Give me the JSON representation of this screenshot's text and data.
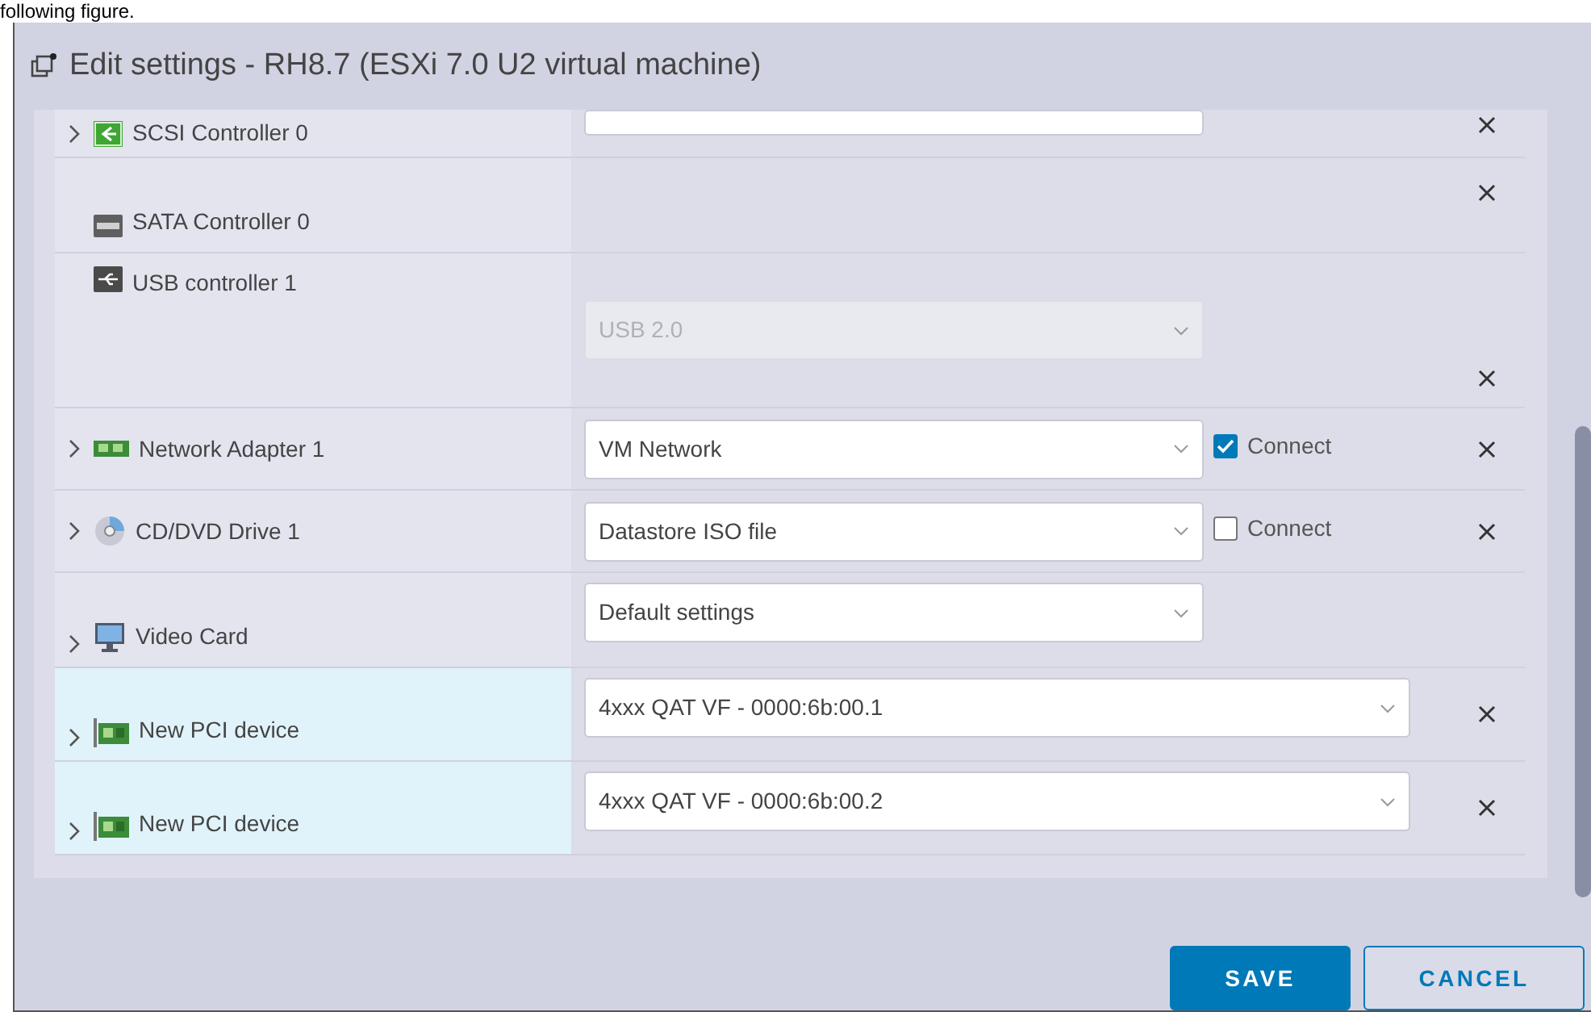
{
  "page_text": "following figure.",
  "dialog": {
    "title": "Edit settings - RH8.7 (ESXi 7.0 U2 virtual machine)"
  },
  "devices": [
    {
      "kind": "scsi",
      "name": "SCSI Controller 0",
      "expandable": true,
      "selected": false,
      "field": {
        "disabled": false,
        "wide": false
      },
      "removable": true
    },
    {
      "kind": "sata",
      "name": "SATA Controller 0",
      "expandable": false,
      "selected": false,
      "removable": true
    },
    {
      "kind": "usb",
      "name": "USB controller 1",
      "expandable": false,
      "selected": false,
      "field": {
        "value": "USB 2.0",
        "disabled": true,
        "wide": false
      },
      "removable": true
    },
    {
      "kind": "network",
      "name": "Network Adapter 1",
      "expandable": true,
      "selected": false,
      "field": {
        "value": "VM Network",
        "disabled": false,
        "wide": false
      },
      "connect": {
        "label": "Connect",
        "checked": true
      },
      "removable": true
    },
    {
      "kind": "cdrom",
      "name": "CD/DVD Drive 1",
      "expandable": true,
      "selected": false,
      "field": {
        "value": "Datastore ISO file",
        "disabled": false,
        "wide": false
      },
      "connect": {
        "label": "Connect",
        "checked": false
      },
      "removable": true
    },
    {
      "kind": "video",
      "name": "Video Card",
      "expandable": true,
      "selected": false,
      "field": {
        "value": "Default settings",
        "disabled": false,
        "wide": false
      },
      "removable": false
    },
    {
      "kind": "pci",
      "name": "New PCI device",
      "expandable": true,
      "selected": true,
      "field": {
        "value": "4xxx QAT VF - 0000:6b:00.1",
        "disabled": false,
        "wide": true
      },
      "removable": true
    },
    {
      "kind": "pci",
      "name": "New PCI device",
      "expandable": true,
      "selected": true,
      "field": {
        "value": "4xxx QAT VF - 0000:6b:00.2",
        "disabled": false,
        "wide": true
      },
      "removable": true
    }
  ],
  "buttons": [
    {
      "kind": "primary",
      "label": "SAVE"
    },
    {
      "kind": "secondary",
      "label": "CANCEL"
    }
  ]
}
